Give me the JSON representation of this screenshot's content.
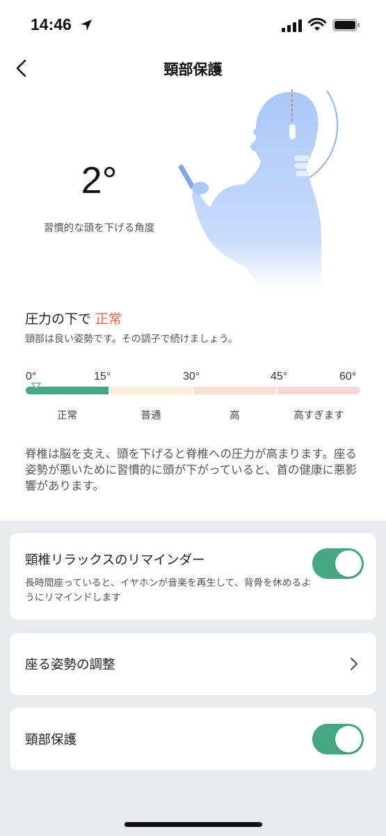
{
  "status_bar": {
    "time": "14:46"
  },
  "header": {
    "title": "頸部保護"
  },
  "angle": {
    "value": "2°",
    "label": "習慣的な頭を下げる角度"
  },
  "pressure": {
    "title": "圧力の下で",
    "status": "正常",
    "status_color": "#e5654f",
    "description": "頸部は良い姿勢です。その調子で続けましょう。"
  },
  "scale": {
    "ticks": [
      "0°",
      "15°",
      "30°",
      "45°",
      "60°"
    ],
    "ranges": [
      "正常",
      "普通",
      "高",
      "高すぎます"
    ],
    "current_angle": 2,
    "colors": {
      "normal": "#46a882",
      "medium": "#fcefdc",
      "high": "#fadfd4",
      "very_high": "#f8d6d4"
    }
  },
  "explanation": "脊椎は脳を支え、頭を下げると脊椎への圧力が高まります。座る姿勢が悪いために習慣的に頭が下がっていると、首の健康に悪影響があります。",
  "cards": {
    "reminder": {
      "title": "頸椎リラックスのリマインダー",
      "description": "長時間座っていると、イヤホンが音楽を再生して、背骨を休めるようにリマインドします",
      "enabled": true
    },
    "sitting_posture": {
      "title": "座る姿勢の調整"
    },
    "neck_protection": {
      "title": "頸部保護",
      "enabled": true
    }
  },
  "accent_color": "#46a882"
}
